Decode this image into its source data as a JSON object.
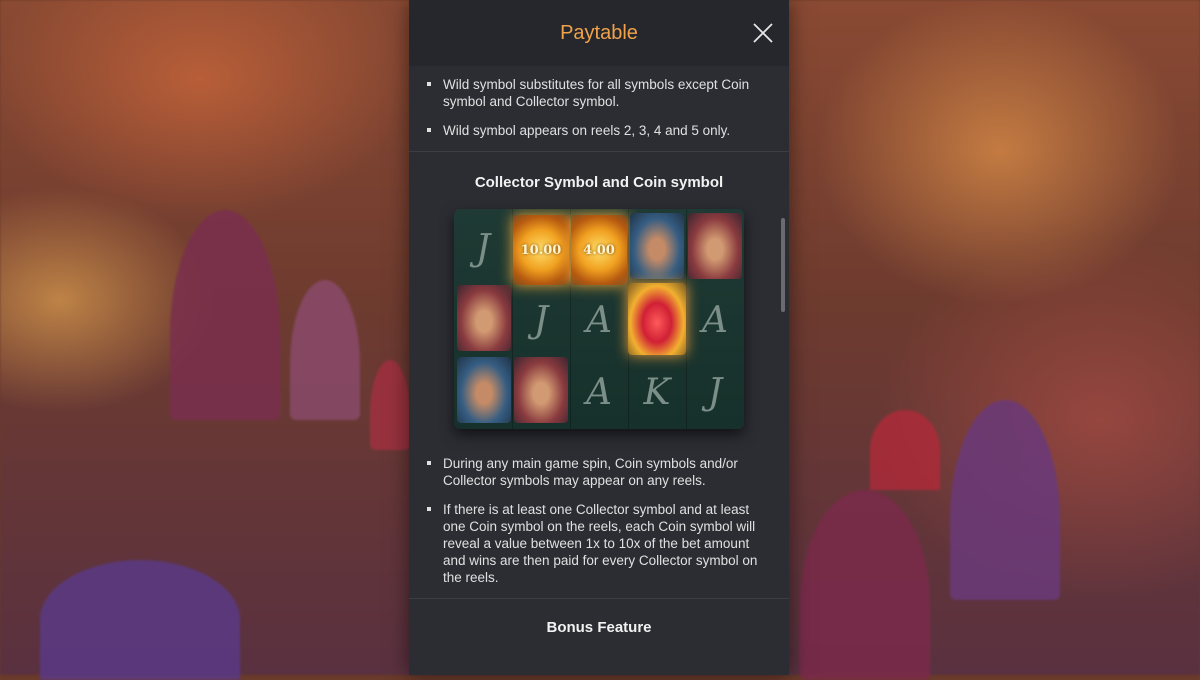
{
  "header": {
    "title": "Paytable"
  },
  "wild_section": {
    "bullets": [
      "Wild symbol substitutes for all symbols except Coin symbol and Collector symbol.",
      "Wild symbol appears on reels 2, 3, 4 and 5 only."
    ]
  },
  "collector_section": {
    "title": "Collector Symbol and Coin symbol",
    "coin_values": [
      "10.00",
      "4.00"
    ],
    "letters": [
      "J",
      "J",
      "A",
      "A",
      "A",
      "K",
      "J"
    ],
    "bullets": [
      "During any main game spin, Coin symbols and/or Collector symbols may appear on any reels.",
      "If there is at least one Collector symbol and at least one Coin symbol on the reels, each Coin symbol will reveal a value between 1x to 10x of the bet amount and wins are then paid for every Collector symbol on the reels."
    ]
  },
  "bonus_section": {
    "title": "Bonus Feature"
  },
  "colors": {
    "accent": "#f0a24a",
    "panel": "#2c2d33"
  }
}
